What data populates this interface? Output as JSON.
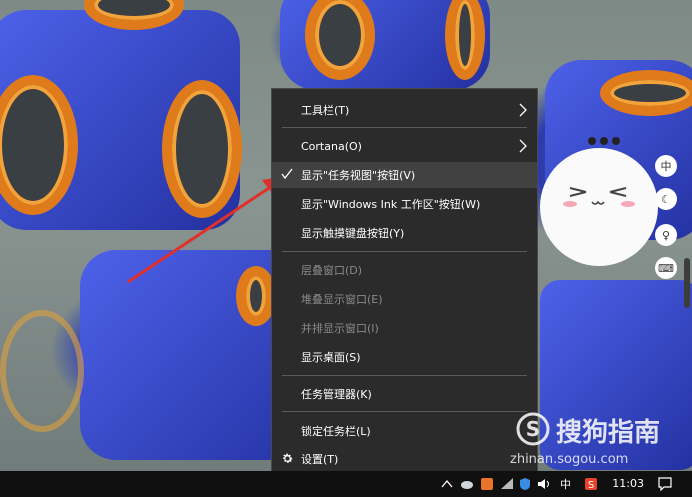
{
  "context_menu": {
    "items": [
      {
        "label": "工具栏(T)",
        "submenu": true
      },
      {
        "label": "Cortana(O)",
        "submenu": true
      },
      {
        "label": "显示\"任务视图\"按钮(V)",
        "checked": true,
        "highlighted": true
      },
      {
        "label": "显示\"Windows Ink 工作区\"按钮(W)"
      },
      {
        "label": "显示触摸键盘按钮(Y)"
      },
      {
        "label": "层叠窗口(D)",
        "disabled": true
      },
      {
        "label": "堆叠显示窗口(E)",
        "disabled": true
      },
      {
        "label": "并排显示窗口(I)",
        "disabled": true
      },
      {
        "label": "显示桌面(S)"
      },
      {
        "label": "任务管理器(K)"
      },
      {
        "label": "锁定任务栏(L)"
      },
      {
        "label": "设置(T)",
        "icon": "gear-icon"
      }
    ]
  },
  "taskbar": {
    "time": "11:03",
    "ime": "中",
    "icons": [
      "chevron-up-icon",
      "cloud-icon",
      "sogou-tray-icon",
      "network-icon",
      "shield-icon",
      "volume-icon",
      "ime-indicator",
      "sogou-icon",
      "notification-icon"
    ]
  },
  "side_widget": {
    "buttons": [
      "中",
      "moon-icon",
      "pin-icon",
      "keyboard-icon"
    ]
  },
  "watermark": {
    "brand": "搜狗指南",
    "url": "zhinan.sogou.com"
  },
  "colors": {
    "menu_bg": "#2b2b2b",
    "menu_highlight": "#414141",
    "annotation_arrow": "#e0302a",
    "taskbar_bg": "#101010"
  }
}
